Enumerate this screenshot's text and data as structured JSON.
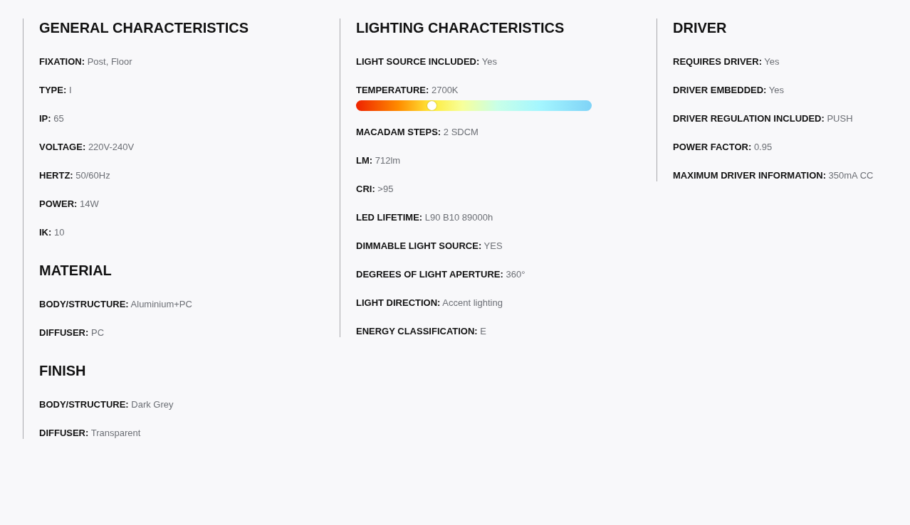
{
  "columns": [
    {
      "sections": [
        {
          "title": "GENERAL CHARACTERISTICS",
          "items": [
            {
              "kind": "text",
              "label": "FIXATION:",
              "value": "Post, Floor"
            },
            {
              "kind": "text",
              "label": "TYPE:",
              "value": "I"
            },
            {
              "kind": "text",
              "label": "IP:",
              "value": "65"
            },
            {
              "kind": "text",
              "label": "VOLTAGE:",
              "value": "220V-240V"
            },
            {
              "kind": "text",
              "label": "HERTZ:",
              "value": "50/60Hz"
            },
            {
              "kind": "text",
              "label": "POWER:",
              "value": "14W"
            },
            {
              "kind": "text",
              "label": "IK:",
              "value": "10"
            }
          ]
        },
        {
          "title": "MATERIAL",
          "items": [
            {
              "kind": "text",
              "label": "BODY/STRUCTURE:",
              "value": "Aluminium+PC"
            },
            {
              "kind": "text",
              "label": "DIFFUSER:",
              "value": "PC"
            }
          ]
        },
        {
          "title": "FINISH",
          "items": [
            {
              "kind": "text",
              "label": "BODY/STRUCTURE:",
              "value": "Dark Grey"
            },
            {
              "kind": "text",
              "label": "DIFFUSER:",
              "value": "Transparent"
            }
          ]
        }
      ]
    },
    {
      "sections": [
        {
          "title": "LIGHTING CHARACTERISTICS",
          "items": [
            {
              "kind": "text",
              "label": "LIGHT SOURCE INCLUDED:",
              "value": "Yes"
            },
            {
              "kind": "slider",
              "label": "TEMPERATURE:",
              "value": "2700K",
              "level": 0.32
            },
            {
              "kind": "text",
              "label": "MACADAM STEPS:",
              "value": "2 SDCM"
            },
            {
              "kind": "text",
              "label": "LM:",
              "value": "712lm"
            },
            {
              "kind": "text",
              "label": "CRI:",
              "value": ">95"
            },
            {
              "kind": "text",
              "label": "LED LIFETIME:",
              "value": "L90 B10 89000h"
            },
            {
              "kind": "text",
              "label": "DIMMABLE LIGHT SOURCE:",
              "value": "YES"
            },
            {
              "kind": "text",
              "label": "DEGREES OF LIGHT APERTURE:",
              "value": "360°"
            },
            {
              "kind": "text",
              "label": "LIGHT DIRECTION:",
              "value": "Accent lighting"
            },
            {
              "kind": "text",
              "label": "ENERGY CLASSIFICATION:",
              "value": "E"
            }
          ]
        }
      ]
    },
    {
      "sections": [
        {
          "title": "DRIVER",
          "items": [
            {
              "kind": "text",
              "label": "REQUIRES DRIVER:",
              "value": "Yes"
            },
            {
              "kind": "text",
              "label": "DRIVER EMBEDDED:",
              "value": "Yes"
            },
            {
              "kind": "text",
              "label": "DRIVER REGULATION INCLUDED:",
              "value": "PUSH"
            },
            {
              "kind": "text",
              "label": "POWER FACTOR:",
              "value": "0.95"
            },
            {
              "kind": "text",
              "label": "MAXIMUM DRIVER INFORMATION:",
              "value": "350mA CC"
            }
          ]
        }
      ]
    }
  ]
}
